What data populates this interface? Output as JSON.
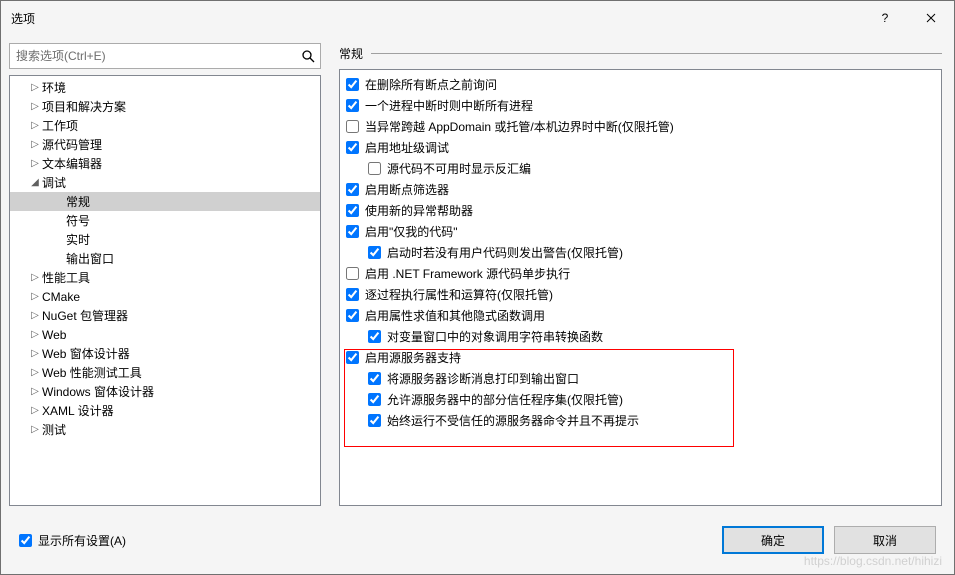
{
  "window": {
    "title": "选项"
  },
  "search": {
    "placeholder": "搜索选项(Ctrl+E)"
  },
  "tree": [
    {
      "label": "环境",
      "lvl": 1,
      "caret": "▷"
    },
    {
      "label": "项目和解决方案",
      "lvl": 1,
      "caret": "▷"
    },
    {
      "label": "工作项",
      "lvl": 1,
      "caret": "▷"
    },
    {
      "label": "源代码管理",
      "lvl": 1,
      "caret": "▷"
    },
    {
      "label": "文本编辑器",
      "lvl": 1,
      "caret": "▷"
    },
    {
      "label": "调试",
      "lvl": 1,
      "caret": "◢"
    },
    {
      "label": "常规",
      "lvl": 2,
      "caret": "",
      "sel": true
    },
    {
      "label": "符号",
      "lvl": 2,
      "caret": ""
    },
    {
      "label": "实时",
      "lvl": 2,
      "caret": ""
    },
    {
      "label": "输出窗口",
      "lvl": 2,
      "caret": ""
    },
    {
      "label": "性能工具",
      "lvl": 1,
      "caret": "▷"
    },
    {
      "label": "CMake",
      "lvl": 1,
      "caret": "▷"
    },
    {
      "label": "NuGet 包管理器",
      "lvl": 1,
      "caret": "▷"
    },
    {
      "label": "Web",
      "lvl": 1,
      "caret": "▷"
    },
    {
      "label": "Web 窗体设计器",
      "lvl": 1,
      "caret": "▷"
    },
    {
      "label": "Web 性能测试工具",
      "lvl": 1,
      "caret": "▷"
    },
    {
      "label": "Windows 窗体设计器",
      "lvl": 1,
      "caret": "▷"
    },
    {
      "label": "XAML 设计器",
      "lvl": 1,
      "caret": "▷"
    },
    {
      "label": "测试",
      "lvl": 1,
      "caret": "▷"
    }
  ],
  "panel": {
    "header": "常规"
  },
  "options": [
    {
      "label": "在删除所有断点之前询问",
      "lvl": 0,
      "chk": true
    },
    {
      "label": "一个进程中断时则中断所有进程",
      "lvl": 0,
      "chk": true
    },
    {
      "label": "当异常跨越 AppDomain 或托管/本机边界时中断(仅限托管)",
      "lvl": 0,
      "chk": false
    },
    {
      "label": "启用地址级调试",
      "lvl": 0,
      "chk": true
    },
    {
      "label": "源代码不可用时显示反汇编",
      "lvl": 1,
      "chk": false
    },
    {
      "label": "启用断点筛选器",
      "lvl": 0,
      "chk": true
    },
    {
      "label": "使用新的异常帮助器",
      "lvl": 0,
      "chk": true
    },
    {
      "label": "启用\"仅我的代码\"",
      "lvl": 0,
      "chk": true
    },
    {
      "label": "启动时若没有用户代码则发出警告(仅限托管)",
      "lvl": 1,
      "chk": true
    },
    {
      "label": "启用 .NET Framework 源代码单步执行",
      "lvl": 0,
      "chk": false
    },
    {
      "label": "逐过程执行属性和运算符(仅限托管)",
      "lvl": 0,
      "chk": true
    },
    {
      "label": "启用属性求值和其他隐式函数调用",
      "lvl": 0,
      "chk": true
    },
    {
      "label": "对变量窗口中的对象调用字符串转换函数",
      "lvl": 1,
      "chk": true
    },
    {
      "label": "启用源服务器支持",
      "lvl": 0,
      "chk": true
    },
    {
      "label": "将源服务器诊断消息打印到输出窗口",
      "lvl": 1,
      "chk": true
    },
    {
      "label": "允许源服务器中的部分信任程序集(仅限托管)",
      "lvl": 1,
      "chk": true
    },
    {
      "label": "始终运行不受信任的源服务器命令并且不再提示",
      "lvl": 1,
      "chk": true
    }
  ],
  "footer": {
    "show_all": "显示所有设置(A)",
    "ok": "确定",
    "cancel": "取消"
  },
  "watermark": "https://blog.csdn.net/hihizi"
}
